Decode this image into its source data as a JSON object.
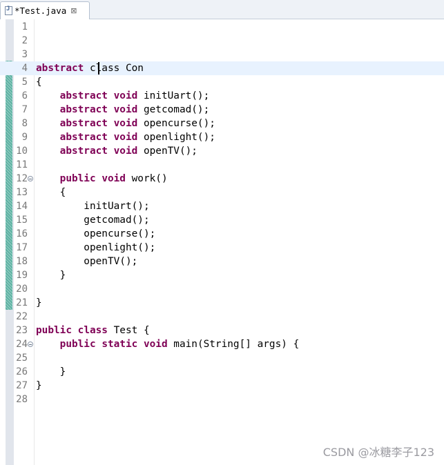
{
  "tab": {
    "icon": "java-file-icon",
    "icon_glyph": "J",
    "title": "*Test.java",
    "close_glyph": "⊠",
    "close_icon": "close-icon"
  },
  "editor": {
    "current_line": 4,
    "lines": [
      {
        "n": "1",
        "tokens": []
      },
      {
        "n": "2",
        "tokens": []
      },
      {
        "n": "3",
        "tokens": []
      },
      {
        "n": "4",
        "tokens": [
          {
            "t": "abstract",
            "k": 1
          },
          {
            "t": " class Con",
            "k": 0
          }
        ]
      },
      {
        "n": "5",
        "tokens": [
          {
            "t": "{",
            "k": 0
          }
        ]
      },
      {
        "n": "6",
        "tokens": [
          {
            "t": "    ",
            "k": 0
          },
          {
            "t": "abstract",
            "k": 1
          },
          {
            "t": " ",
            "k": 0
          },
          {
            "t": "void",
            "k": 1
          },
          {
            "t": " initUart();",
            "k": 0
          }
        ]
      },
      {
        "n": "7",
        "tokens": [
          {
            "t": "    ",
            "k": 0
          },
          {
            "t": "abstract",
            "k": 1
          },
          {
            "t": " ",
            "k": 0
          },
          {
            "t": "void",
            "k": 1
          },
          {
            "t": " getcomad();",
            "k": 0
          }
        ]
      },
      {
        "n": "8",
        "tokens": [
          {
            "t": "    ",
            "k": 0
          },
          {
            "t": "abstract",
            "k": 1
          },
          {
            "t": " ",
            "k": 0
          },
          {
            "t": "void",
            "k": 1
          },
          {
            "t": " opencurse();",
            "k": 0
          }
        ]
      },
      {
        "n": "9",
        "tokens": [
          {
            "t": "    ",
            "k": 0
          },
          {
            "t": "abstract",
            "k": 1
          },
          {
            "t": " ",
            "k": 0
          },
          {
            "t": "void",
            "k": 1
          },
          {
            "t": " openlight();",
            "k": 0
          }
        ]
      },
      {
        "n": "10",
        "tokens": [
          {
            "t": "    ",
            "k": 0
          },
          {
            "t": "abstract",
            "k": 1
          },
          {
            "t": " ",
            "k": 0
          },
          {
            "t": "void",
            "k": 1
          },
          {
            "t": " openTV();",
            "k": 0
          }
        ]
      },
      {
        "n": "11",
        "tokens": []
      },
      {
        "n": "12",
        "fold": true,
        "tokens": [
          {
            "t": "    ",
            "k": 0
          },
          {
            "t": "public",
            "k": 1
          },
          {
            "t": " ",
            "k": 0
          },
          {
            "t": "void",
            "k": 1
          },
          {
            "t": " work()",
            "k": 0
          }
        ]
      },
      {
        "n": "13",
        "tokens": [
          {
            "t": "    {",
            "k": 0
          }
        ]
      },
      {
        "n": "14",
        "tokens": [
          {
            "t": "        initUart();",
            "k": 0
          }
        ]
      },
      {
        "n": "15",
        "tokens": [
          {
            "t": "        getcomad();",
            "k": 0
          }
        ]
      },
      {
        "n": "16",
        "tokens": [
          {
            "t": "        opencurse();",
            "k": 0
          }
        ]
      },
      {
        "n": "17",
        "tokens": [
          {
            "t": "        openlight();",
            "k": 0
          }
        ]
      },
      {
        "n": "18",
        "tokens": [
          {
            "t": "        openTV();",
            "k": 0
          }
        ]
      },
      {
        "n": "19",
        "tokens": [
          {
            "t": "    }",
            "k": 0
          }
        ]
      },
      {
        "n": "20",
        "tokens": []
      },
      {
        "n": "21",
        "tokens": [
          {
            "t": "}",
            "k": 0
          }
        ]
      },
      {
        "n": "22",
        "tokens": []
      },
      {
        "n": "23",
        "tokens": [
          {
            "t": "public",
            "k": 1
          },
          {
            "t": " ",
            "k": 0
          },
          {
            "t": "class",
            "k": 1
          },
          {
            "t": " Test {",
            "k": 0
          }
        ]
      },
      {
        "n": "24",
        "fold": true,
        "tokens": [
          {
            "t": "    ",
            "k": 0
          },
          {
            "t": "public",
            "k": 1
          },
          {
            "t": " ",
            "k": 0
          },
          {
            "t": "static",
            "k": 1
          },
          {
            "t": " ",
            "k": 0
          },
          {
            "t": "void",
            "k": 1
          },
          {
            "t": " main(String[] args) {",
            "k": 0
          }
        ]
      },
      {
        "n": "25",
        "tokens": []
      },
      {
        "n": "26",
        "tokens": [
          {
            "t": "    }",
            "k": 0
          }
        ]
      },
      {
        "n": "27",
        "tokens": [
          {
            "t": "}",
            "k": 0
          }
        ]
      },
      {
        "n": "28",
        "tokens": []
      }
    ]
  },
  "colors": {
    "keyword": "#7f0055",
    "line_number": "#787878",
    "current_line_bg": "#e8f2fe",
    "change_bar": "#5fb3a4"
  },
  "watermark": "CSDN @冰糖李子123"
}
